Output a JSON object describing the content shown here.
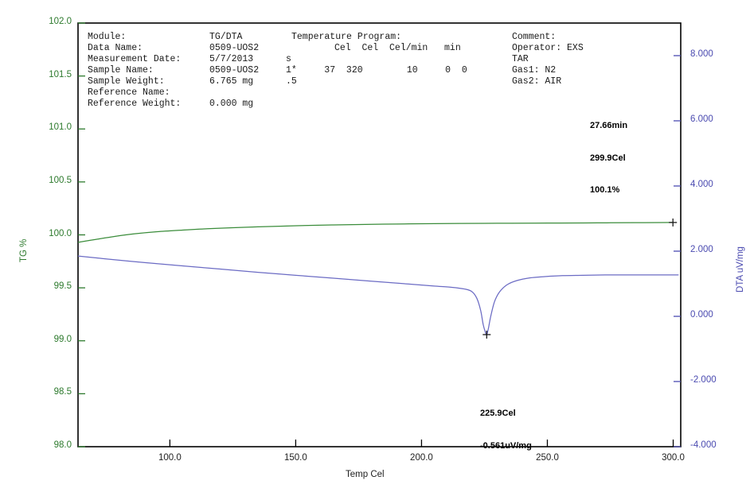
{
  "header": {
    "col1": [
      "Module:",
      "Data Name:",
      "Measurement Date:",
      "Sample Name:",
      "Sample Weight:",
      "Reference Name:",
      "Reference Weight:"
    ],
    "col2": [
      "TG/DTA",
      "0509-UOS2",
      "5/7/2013",
      "0509-UOS2",
      "6.765 mg",
      "",
      "0.000 mg"
    ],
    "program_title": "Temperature Program:",
    "program_units": "Cel  Cel  Cel/min   min",
    "program_row_s": "s",
    "program_row_1": "1*     37  320        10     0  0",
    "program_row_5": ".5",
    "comment_title": "Comment:",
    "operator": "Operator: EXS",
    "tar": "TAR",
    "gas1": "Gas1: N2",
    "gas2": "Gas2: AIR"
  },
  "annotations": {
    "endpoint": {
      "line1": "27.66min",
      "line2": "299.9Cel",
      "line3": "100.1%"
    },
    "peak": {
      "line1": "225.9Cel",
      "line2": "-0.561uV/mg"
    }
  },
  "colors": {
    "tg_curve": "#3a8c3a",
    "dta_curve": "#6b6bc4",
    "axis": "#000000",
    "tg_axis_text": "#2d7a2d",
    "dta_axis_text": "#4a4ab0",
    "text": "#1a1a1a"
  },
  "chart_data": {
    "type": "line",
    "title": "",
    "xlabel": "Temp Cel",
    "xlim": [
      63.5,
      303.0
    ],
    "xticks": [
      100.0,
      150.0,
      200.0,
      250.0,
      300.0
    ],
    "xtick_labels": [
      "100.0",
      "150.0",
      "200.0",
      "250.0",
      "300.0"
    ],
    "grid": false,
    "legend": "none",
    "axes": [
      {
        "id": "left",
        "label": "TG %",
        "color": "#2d7a2d",
        "ylim": [
          98.0,
          102.0
        ],
        "yticks": [
          98.0,
          98.5,
          99.0,
          99.5,
          100.0,
          100.5,
          101.0,
          101.5,
          102.0
        ],
        "ytick_labels": [
          "98.0",
          "98.5",
          "99.0",
          "99.5",
          "100.0",
          "100.5",
          "101.0",
          "101.5",
          "102.0"
        ]
      },
      {
        "id": "right",
        "label": "DTA uV/mg",
        "color": "#4a4ab0",
        "ylim": [
          -4.0,
          9.0
        ],
        "yticks": [
          -4.0,
          -2.0,
          0.0,
          2.0,
          4.0,
          6.0,
          8.0
        ],
        "ytick_labels": [
          "-4.000",
          "-2.000",
          "0.000",
          "2.000",
          "4.000",
          "6.000",
          "8.000"
        ]
      }
    ],
    "series": [
      {
        "name": "TG %",
        "axis": "left",
        "color": "#3a8c3a",
        "x": [
          63.5,
          70,
          78,
          86,
          95,
          105,
          115,
          125,
          135,
          145,
          155,
          165,
          175,
          185,
          195,
          205,
          215,
          225,
          235,
          245,
          255,
          265,
          275,
          285,
          295,
          299.9
        ],
        "y": [
          99.93,
          99.955,
          99.985,
          100.01,
          100.03,
          100.045,
          100.058,
          100.068,
          100.076,
          100.083,
          100.089,
          100.094,
          100.098,
          100.101,
          100.104,
          100.106,
          100.108,
          100.109,
          100.11,
          100.111,
          100.112,
          100.113,
          100.114,
          100.115,
          100.116,
          100.117
        ]
      },
      {
        "name": "DTA uV/mg",
        "axis": "right",
        "color": "#6b6bc4",
        "x": [
          63.5,
          75,
          90,
          105,
          120,
          135,
          150,
          165,
          180,
          195,
          205,
          212,
          217,
          220,
          222,
          223.5,
          224.5,
          225.3,
          225.9,
          226.5,
          227.5,
          229,
          231,
          234,
          238,
          243,
          249,
          256,
          264,
          273,
          283,
          293,
          302
        ],
        "y": [
          1.85,
          1.76,
          1.65,
          1.55,
          1.45,
          1.35,
          1.26,
          1.17,
          1.08,
          0.99,
          0.93,
          0.89,
          0.84,
          0.76,
          0.55,
          0.18,
          -0.25,
          -0.47,
          -0.561,
          -0.4,
          0.0,
          0.45,
          0.75,
          0.97,
          1.1,
          1.18,
          1.22,
          1.25,
          1.26,
          1.27,
          1.27,
          1.27,
          1.27
        ]
      }
    ],
    "markers": [
      {
        "name": "tg-endpoint-marker",
        "axis": "left",
        "x": 299.9,
        "y": 100.117,
        "glyph": "cross",
        "color": "#1a1a1a"
      },
      {
        "name": "dta-peak-marker",
        "axis": "right",
        "x": 225.9,
        "y": -0.561,
        "glyph": "cross",
        "color": "#1a1a1a"
      }
    ]
  }
}
